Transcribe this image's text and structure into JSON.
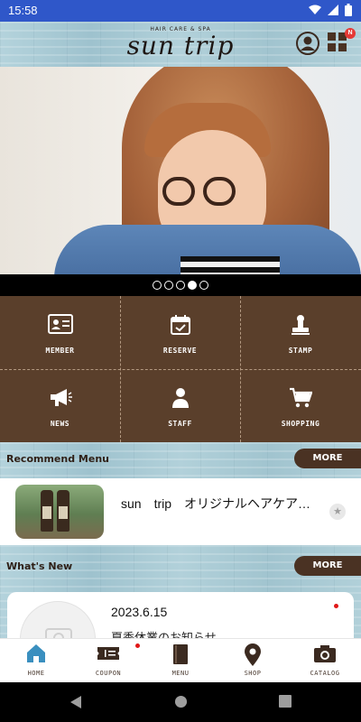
{
  "status_bar": {
    "time": "15:58"
  },
  "header": {
    "brand_sub": "HAIR CARE & SPA",
    "brand": "sun trip",
    "notification_badge": "N"
  },
  "carousel": {
    "count": 5,
    "active_index": 3
  },
  "menu": [
    {
      "label": "MEMBER",
      "icon": "member-card-icon"
    },
    {
      "label": "RESERVE",
      "icon": "calendar-check-icon"
    },
    {
      "label": "STAMP",
      "icon": "stamp-icon"
    },
    {
      "label": "NEWS",
      "icon": "megaphone-icon"
    },
    {
      "label": "STAFF",
      "icon": "person-icon"
    },
    {
      "label": "SHOPPING",
      "icon": "cart-icon"
    }
  ],
  "recommend": {
    "title": "Recommend Menu",
    "more": "MORE",
    "item_title": "sun　trip　オリジナルヘアケアブ…"
  },
  "whats_new": {
    "title": "What's New",
    "more": "MORE",
    "item_date": "2023.6.15",
    "item_body": "夏季休業のお知らせ"
  },
  "bottom_nav": [
    {
      "label": "HOME",
      "icon": "home-icon"
    },
    {
      "label": "COUPON",
      "icon": "coupon-icon"
    },
    {
      "label": "MENU",
      "icon": "book-icon"
    },
    {
      "label": "SHOP",
      "icon": "map-pin-icon"
    },
    {
      "label": "CATALOG",
      "icon": "camera-icon"
    }
  ],
  "colors": {
    "brown": "#5a3f2b",
    "status_bar": "#2f57c9",
    "wood_blue": "#a9cad5",
    "accent_red": "#e01818",
    "home_active": "#3a8fbf"
  }
}
